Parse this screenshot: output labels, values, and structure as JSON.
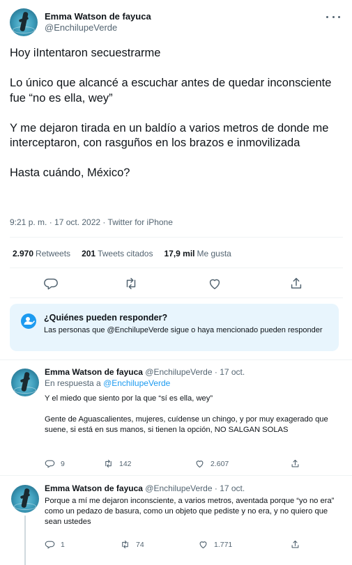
{
  "tweet": {
    "name": "Emma Watson de fayuca",
    "handle": "@EnchilupeVerde",
    "paragraphs": [
      "Hoy iIntentaron secuestrarme",
      "Lo único que alcancé a escuchar antes de quedar inconsciente fue “no es ella, wey”",
      "Y me dejaron tirada en un baldío a varios metros de donde me interceptaron, con rasguños en los brazos e inmovilizada",
      "Hasta cuándo, México?"
    ],
    "timestamp": "9:21 p. m. · 17 oct. 2022 · Twitter for iPhone",
    "stats": {
      "retweets_count": "2.970",
      "retweets_label": "Retweets",
      "quotes_count": "201",
      "quotes_label": "Tweets citados",
      "likes_count": "17,9 mil",
      "likes_label": "Me gusta"
    }
  },
  "reply_restriction": {
    "title": "¿Quiénes pueden responder?",
    "description": "Las personas que @EnchilupeVerde sigue o haya mencionado pueden responder"
  },
  "replies": [
    {
      "name": "Emma Watson de fayuca",
      "handle_date": "@EnchilupeVerde · 17 oct.",
      "reply_prefix": "En respuesta a ",
      "reply_to": "@EnchilupeVerde",
      "paragraphs": [
        "Y el miedo que siento por la que “sí es ella, wey”",
        "Gente de Aguascalientes, mujeres, cuídense un chingo, y por muy exagerado que suene, si está en sus manos, si tienen la opción, NO SALGAN SOLAS"
      ],
      "replies": "9",
      "retweets": "142",
      "likes": "2.607"
    },
    {
      "name": "Emma Watson de fayuca",
      "handle_date": "@EnchilupeVerde · 17 oct.",
      "paragraphs": [
        "Porque a mí me dejaron inconsciente, a varios metros, aventada porque “yo no era” como un pedazo de basura, como un objeto que pediste y no era, y no quiero que sean ustedes"
      ],
      "replies": "1",
      "retweets": "74",
      "likes": "1.771"
    }
  ],
  "icons": {
    "reply": "reply-icon",
    "retweet": "retweet-icon",
    "like": "heart-icon",
    "share": "share-icon",
    "more": "more-icon",
    "restriction": "user-check-icon"
  },
  "colors": {
    "accent": "#1d9bf0",
    "muted": "#536471",
    "reply_box_bg": "#e8f5fd"
  }
}
